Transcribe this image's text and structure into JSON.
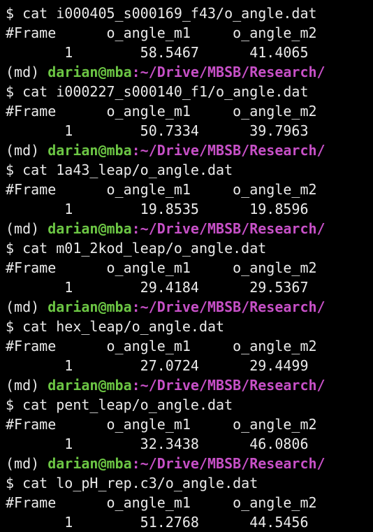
{
  "terminal": {
    "colors": {
      "background": "#000000",
      "text": "#eaeaea",
      "user": "#6cc644",
      "path": "#c750c7"
    },
    "prompt": {
      "symbol": "$",
      "env": "(md)",
      "user_host": "darian@mba",
      "cwd": ":~/Drive/MBSB/Research/"
    },
    "blocks": [
      {
        "command": "cat i000405_s000169_f43/o_angle.dat",
        "header": [
          "#Frame",
          "o_angle_m1",
          "o_angle_m2"
        ],
        "row": [
          "1",
          "58.5467",
          "41.4065"
        ]
      },
      {
        "command": "cat i000227_s000140_f1/o_angle.dat",
        "header": [
          "#Frame",
          "o_angle_m1",
          "o_angle_m2"
        ],
        "row": [
          "1",
          "50.7334",
          "39.7963"
        ]
      },
      {
        "command": "cat 1a43_leap/o_angle.dat",
        "header": [
          "#Frame",
          "o_angle_m1",
          "o_angle_m2"
        ],
        "row": [
          "1",
          "19.8535",
          "19.8596"
        ]
      },
      {
        "command": "cat m01_2kod_leap/o_angle.dat",
        "header": [
          "#Frame",
          "o_angle_m1",
          "o_angle_m2"
        ],
        "row": [
          "1",
          "29.4184",
          "29.5367"
        ]
      },
      {
        "command": "cat hex_leap/o_angle.dat",
        "header": [
          "#Frame",
          "o_angle_m1",
          "o_angle_m2"
        ],
        "row": [
          "1",
          "27.0724",
          "29.4499"
        ]
      },
      {
        "command": "cat pent_leap/o_angle.dat",
        "header": [
          "#Frame",
          "o_angle_m1",
          "o_angle_m2"
        ],
        "row": [
          "1",
          "32.3438",
          "46.0806"
        ]
      },
      {
        "command": "cat lo_pH_rep.c3/o_angle.dat",
        "header": [
          "#Frame",
          "o_angle_m1",
          "o_angle_m2"
        ],
        "row": [
          "1",
          "51.2768",
          "44.5456"
        ]
      }
    ]
  }
}
